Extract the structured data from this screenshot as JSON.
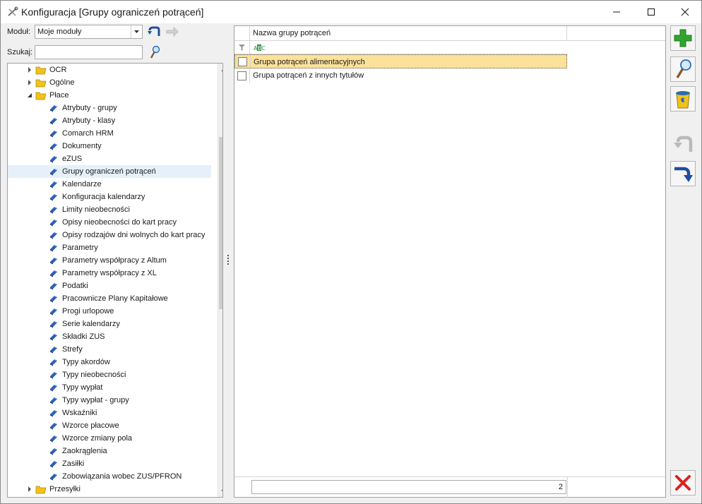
{
  "window": {
    "title": "Konfiguracja [Grupy ograniczeń potrąceń]"
  },
  "module": {
    "label": "Moduł:",
    "value": "Moje moduły"
  },
  "search": {
    "label": "Szukaj:",
    "value": ""
  },
  "tree": {
    "items": [
      {
        "label": "OCR",
        "kind": "folder",
        "expanded": false
      },
      {
        "label": "Ogólne",
        "kind": "folder",
        "expanded": false
      },
      {
        "label": "Płace",
        "kind": "folder",
        "expanded": true
      },
      {
        "label": "Atrybuty - grupy",
        "kind": "leaf"
      },
      {
        "label": "Atrybuty - klasy",
        "kind": "leaf"
      },
      {
        "label": "Comarch HRM",
        "kind": "leaf"
      },
      {
        "label": "Dokumenty",
        "kind": "leaf"
      },
      {
        "label": "eZUS",
        "kind": "leaf"
      },
      {
        "label": "Grupy ograniczeń potrąceń",
        "kind": "leaf",
        "selected": true
      },
      {
        "label": "Kalendarze",
        "kind": "leaf"
      },
      {
        "label": "Konfiguracja kalendarzy",
        "kind": "leaf"
      },
      {
        "label": "Limity nieobecności",
        "kind": "leaf"
      },
      {
        "label": "Opisy nieobecności do kart pracy",
        "kind": "leaf"
      },
      {
        "label": "Opisy rodzajów dni wolnych do kart pracy",
        "kind": "leaf"
      },
      {
        "label": "Parametry",
        "kind": "leaf"
      },
      {
        "label": "Parametry współpracy z Altum",
        "kind": "leaf"
      },
      {
        "label": "Parametry współpracy z XL",
        "kind": "leaf"
      },
      {
        "label": "Podatki",
        "kind": "leaf"
      },
      {
        "label": "Pracownicze Plany Kapitałowe",
        "kind": "leaf"
      },
      {
        "label": "Progi urlopowe",
        "kind": "leaf"
      },
      {
        "label": "Serie kalendarzy",
        "kind": "leaf"
      },
      {
        "label": "Składki ZUS",
        "kind": "leaf"
      },
      {
        "label": "Strefy",
        "kind": "leaf"
      },
      {
        "label": "Typy akordów",
        "kind": "leaf"
      },
      {
        "label": "Typy nieobecności",
        "kind": "leaf"
      },
      {
        "label": "Typy wypłat",
        "kind": "leaf"
      },
      {
        "label": "Typy wypłat - grupy",
        "kind": "leaf"
      },
      {
        "label": "Wskaźniki",
        "kind": "leaf"
      },
      {
        "label": "Wzorce płacowe",
        "kind": "leaf"
      },
      {
        "label": "Wzorce zmiany pola",
        "kind": "leaf"
      },
      {
        "label": "Zaokrąglenia",
        "kind": "leaf"
      },
      {
        "label": "Zasiłki",
        "kind": "leaf"
      },
      {
        "label": "Zobowiązania wobec ZUS/PFRON",
        "kind": "leaf"
      },
      {
        "label": "Przesyłki",
        "kind": "folder",
        "expanded": false
      }
    ]
  },
  "grid": {
    "column_header": "Nazwa grupy potrąceń",
    "rows": [
      {
        "name": "Grupa potrąceń alimentacyjnych",
        "checked": false,
        "selected": true
      },
      {
        "name": "Grupa potrąceń z innych tytułów",
        "checked": false,
        "selected": false
      }
    ],
    "record_count": "2"
  },
  "colors": {
    "accent_green": "#2fa52f",
    "selected_row": "#fce19a",
    "tree_selected": "#e5f0fb",
    "close_red": "#e02020",
    "folder_yellow": "#f2c21b",
    "leaf_blue": "#2b5fb8"
  },
  "icons": {
    "add": "plus-icon",
    "edit": "magnifier-icon",
    "delete": "trash-icon",
    "undo": "undo-arrow-icon",
    "redo": "redo-arrow-icon",
    "close": "x-icon"
  }
}
